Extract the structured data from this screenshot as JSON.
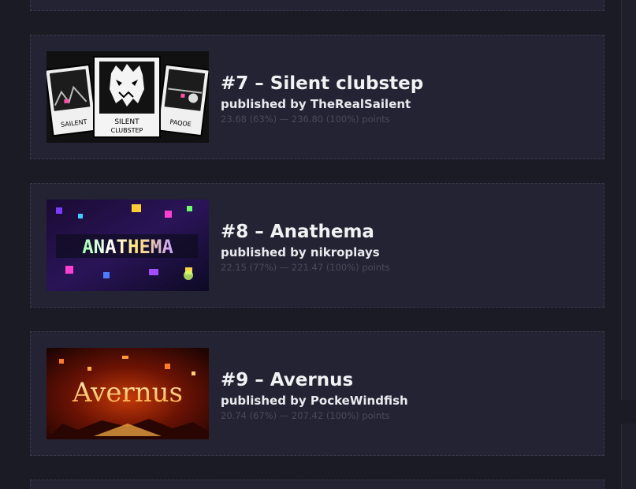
{
  "levels": [
    {
      "rank": "#7",
      "title": "#7 – Silent clubstep",
      "publisher": "published by TheRealSailent",
      "points": "23.68 (63%) — 236.80 (100%) points",
      "thumbnail_text": [
        "SAILENT",
        "SILENT",
        "CLUBSTEP",
        "PAQOE"
      ]
    },
    {
      "rank": "#8",
      "title": "#8 – Anathema",
      "publisher": "published by nikroplays",
      "points": "22.15 (77%) — 221.47 (100%) points",
      "thumbnail_text": [
        "ANATHEMA"
      ]
    },
    {
      "rank": "#9",
      "title": "#9 – Avernus",
      "publisher": "published by PockeWindfish",
      "points": "20.74 (67%) — 207.42 (100%) points",
      "thumbnail_text": [
        "Avernus"
      ]
    }
  ],
  "colors": {
    "background": "#1b1b26",
    "card": "#232333",
    "card_border": "#393949",
    "title": "#f2f2f5",
    "muted": "#4a4a5a"
  }
}
